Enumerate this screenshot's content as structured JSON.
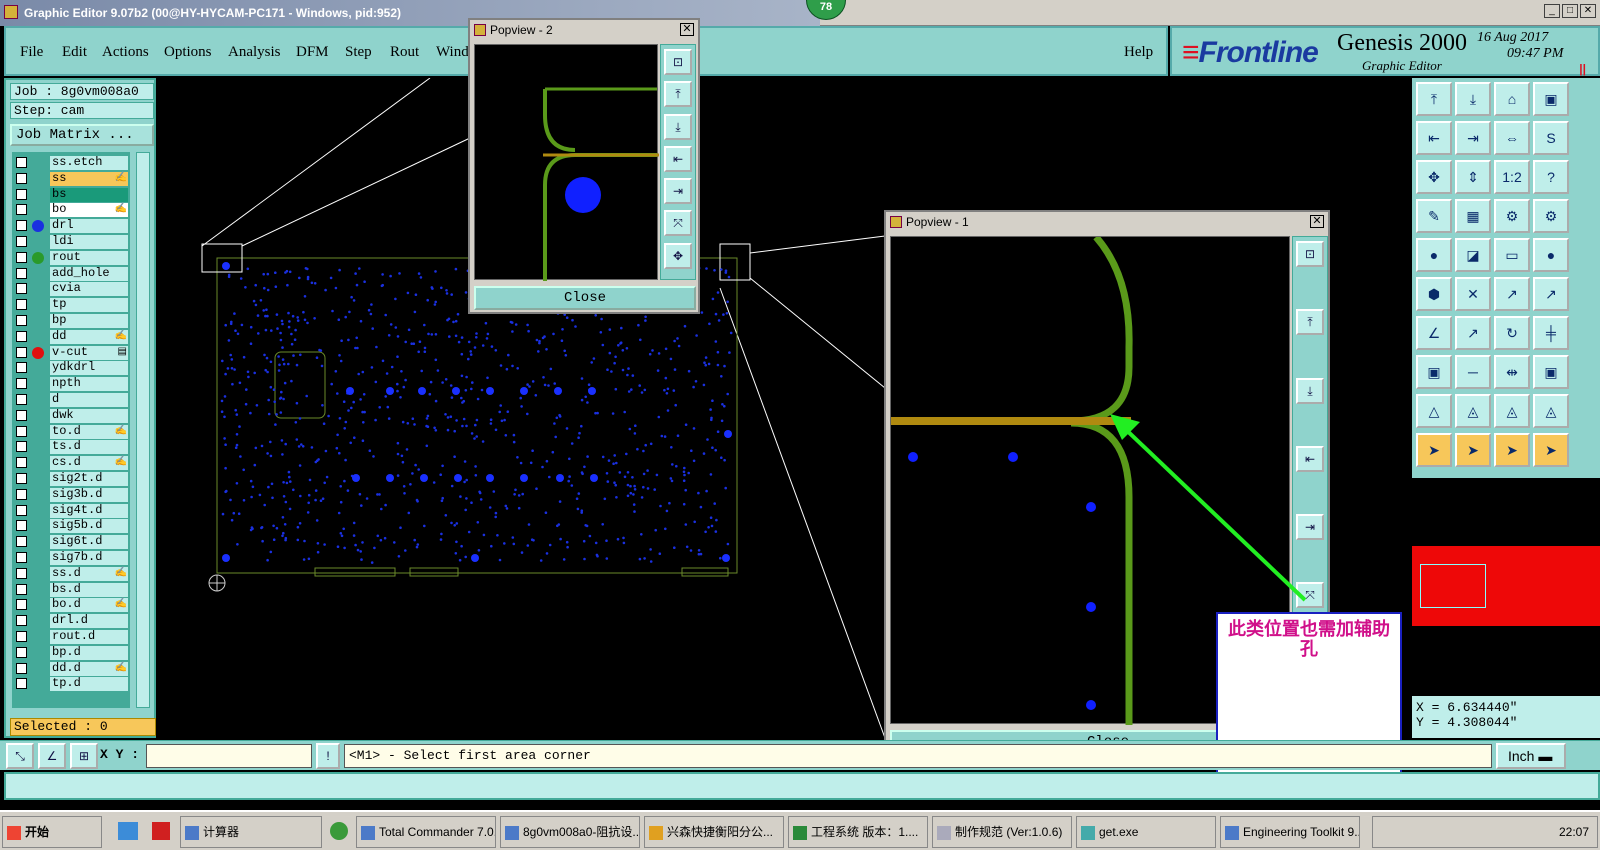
{
  "window": {
    "title": "Graphic Editor 9.07b2 (00@HY-HYCAM-PC171 - Windows, pid:952)",
    "badge": "78"
  },
  "menu": {
    "items": [
      "File",
      "Edit",
      "Actions",
      "Options",
      "Analysis",
      "DFM",
      "Step",
      "Rout",
      "Windo"
    ],
    "help": "Help"
  },
  "brand": {
    "logo": "Frontline",
    "product": "Genesis 2000",
    "subtitle": "Graphic Editor",
    "date": "16 Aug 2017",
    "time": "09:47 PM",
    "pause": "||"
  },
  "job": {
    "job_label": "Job : 8g0vm008a0",
    "step_label": "Step: cam",
    "matrix_button": "Job Matrix ...",
    "selected": "Selected : 0"
  },
  "layers": [
    {
      "name": "ss.etch",
      "dot": "",
      "bg": ""
    },
    {
      "name": "ss",
      "dot": "",
      "bg": "#f7c75a",
      "mk": "✍"
    },
    {
      "name": "bs",
      "dot": "",
      "bg": "#1a9a7a"
    },
    {
      "name": "bo",
      "dot": "",
      "bg": "#ffffff",
      "mk": "✍"
    },
    {
      "name": "drl",
      "dot": "#1a30e0",
      "bg": ""
    },
    {
      "name": "ldi",
      "dot": "",
      "bg": ""
    },
    {
      "name": "rout",
      "dot": "#2a9a2a",
      "bg": ""
    },
    {
      "name": "add_hole",
      "dot": "",
      "bg": ""
    },
    {
      "name": "cvia",
      "dot": "",
      "bg": ""
    },
    {
      "name": "tp",
      "dot": "",
      "bg": ""
    },
    {
      "name": "bp",
      "dot": "",
      "bg": ""
    },
    {
      "name": "dd",
      "dot": "",
      "bg": "",
      "mk": "✍"
    },
    {
      "name": "v-cut",
      "dot": "#e01010",
      "bg": "",
      "mk": "▤"
    },
    {
      "name": "ydkdrl",
      "dot": "",
      "bg": ""
    },
    {
      "name": "npth",
      "dot": "",
      "bg": ""
    },
    {
      "name": "d",
      "dot": "",
      "bg": ""
    },
    {
      "name": "dwk",
      "dot": "",
      "bg": ""
    },
    {
      "name": "to.d",
      "dot": "",
      "bg": "",
      "mk": "✍"
    },
    {
      "name": "ts.d",
      "dot": "",
      "bg": ""
    },
    {
      "name": "cs.d",
      "dot": "",
      "bg": "",
      "mk": "✍"
    },
    {
      "name": "sig2t.d",
      "dot": "",
      "bg": ""
    },
    {
      "name": "sig3b.d",
      "dot": "",
      "bg": ""
    },
    {
      "name": "sig4t.d",
      "dot": "",
      "bg": ""
    },
    {
      "name": "sig5b.d",
      "dot": "",
      "bg": ""
    },
    {
      "name": "sig6t.d",
      "dot": "",
      "bg": ""
    },
    {
      "name": "sig7b.d",
      "dot": "",
      "bg": ""
    },
    {
      "name": "ss.d",
      "dot": "",
      "bg": "",
      "mk": "✍"
    },
    {
      "name": "bs.d",
      "dot": "",
      "bg": ""
    },
    {
      "name": "bo.d",
      "dot": "",
      "bg": "",
      "mk": "✍"
    },
    {
      "name": "drl.d",
      "dot": "",
      "bg": ""
    },
    {
      "name": "rout.d",
      "dot": "",
      "bg": ""
    },
    {
      "name": "bp.d",
      "dot": "",
      "bg": ""
    },
    {
      "name": "dd.d",
      "dot": "",
      "bg": "",
      "mk": "✍"
    },
    {
      "name": "tp.d",
      "dot": "",
      "bg": ""
    }
  ],
  "popview2": {
    "title": "Popview - 2",
    "close": "Close",
    "x_btn": "✕"
  },
  "popview1": {
    "title": "Popview - 1",
    "close": "Close",
    "x_btn": "✕"
  },
  "annotation": {
    "text": "此类位置也需加辅助孔"
  },
  "coords": {
    "x": "X =  6.634440\"",
    "y": "Y =  4.308044\""
  },
  "status": {
    "xy_label": "X Y :",
    "xy_value": "",
    "bang": "!",
    "message": "<M1> - Select first area corner",
    "units": "Inch"
  },
  "taskbar": {
    "start": "开始",
    "items": [
      "计算器",
      "Total Commander 7.0...",
      "8g0vm008a0-阻抗设...",
      "兴森快捷衡阳分公...",
      "工程系统  版本：1....",
      "制作规范 (Ver:1.0.6)",
      "get.exe",
      "Engineering Toolkit 9...."
    ],
    "clock": "22:07"
  }
}
